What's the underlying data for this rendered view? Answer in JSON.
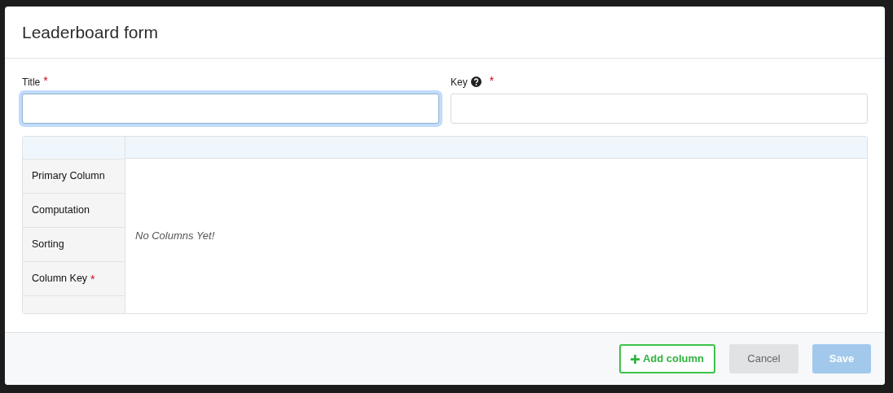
{
  "dialog": {
    "title": "Leaderboard form"
  },
  "fields": [
    {
      "label": "Title",
      "required_mark": "*",
      "help": false,
      "focused": true
    },
    {
      "label": "Key",
      "required_mark": "*",
      "help": true,
      "focused": false
    }
  ],
  "columns_table": {
    "row_labels": [
      {
        "label": "Primary Column"
      },
      {
        "label": "Computation"
      },
      {
        "label": "Sorting"
      },
      {
        "label": "Column Key",
        "required_mark": "*"
      }
    ],
    "empty_text": "No Columns Yet!"
  },
  "buttons": [
    {
      "label": "Add column",
      "kind": "add",
      "disabled": false
    },
    {
      "label": "Cancel",
      "kind": "cancel",
      "disabled": false
    },
    {
      "label": "Save",
      "kind": "save",
      "disabled": true
    }
  ]
}
